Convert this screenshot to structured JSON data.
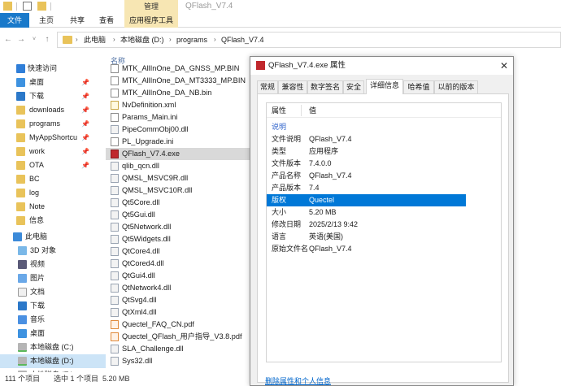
{
  "window": {
    "title": "QFlash_V7.4",
    "manage_label": "管理"
  },
  "ribbon": {
    "tabs": [
      "文件",
      "主页",
      "共享",
      "查看",
      "应用程序工具"
    ]
  },
  "address": {
    "crumbs": [
      "此电脑",
      "本地磁盘 (D:)",
      "programs",
      "QFlash_V7.4"
    ]
  },
  "nav": {
    "items": [
      {
        "label": "快速访问",
        "icon": "star-icon",
        "pinned": false
      },
      {
        "label": "桌面",
        "icon": "desktop-icon",
        "pinned": true
      },
      {
        "label": "下载",
        "icon": "download-icon",
        "pinned": true
      },
      {
        "label": "downloads",
        "icon": "folder-icon",
        "pinned": true
      },
      {
        "label": "programs",
        "icon": "folder-icon",
        "pinned": true
      },
      {
        "label": "MyAppShortcu",
        "icon": "folder-icon",
        "pinned": true
      },
      {
        "label": "work",
        "icon": "folder-icon",
        "pinned": true
      },
      {
        "label": "OTA",
        "icon": "folder-icon",
        "pinned": true
      },
      {
        "label": "BC",
        "icon": "folder-icon",
        "pinned": false
      },
      {
        "label": "log",
        "icon": "folder-icon",
        "pinned": false
      },
      {
        "label": "Note",
        "icon": "folder-icon",
        "pinned": false
      },
      {
        "label": "信息",
        "icon": "folder-icon",
        "pinned": false
      },
      {
        "label": "此电脑",
        "icon": "computer-icon",
        "pinned": false
      },
      {
        "label": "3D 对象",
        "icon": "cube-icon",
        "pinned": false
      },
      {
        "label": "视频",
        "icon": "video-icon",
        "pinned": false
      },
      {
        "label": "图片",
        "icon": "picture-icon",
        "pinned": false
      },
      {
        "label": "文档",
        "icon": "document-icon",
        "pinned": false
      },
      {
        "label": "下载",
        "icon": "download-icon",
        "pinned": false
      },
      {
        "label": "音乐",
        "icon": "music-icon",
        "pinned": false
      },
      {
        "label": "桌面",
        "icon": "desktop-icon",
        "pinned": false
      },
      {
        "label": "本地磁盘 (C:)",
        "icon": "drive-icon",
        "pinned": false
      },
      {
        "label": "本地磁盘 (D:)",
        "icon": "drive-icon",
        "pinned": false
      },
      {
        "label": "本地磁盘 (E:)",
        "icon": "drive-icon",
        "pinned": false
      }
    ]
  },
  "filelist": {
    "column_name": "名称",
    "files": [
      {
        "name": "MTK_AllInOne_DA_GNSS_MP.BIN",
        "type": "file"
      },
      {
        "name": "MTK_AllInOne_DA_MT3333_MP.BIN",
        "type": "file"
      },
      {
        "name": "MTK_AllInOne_DA_NB.bin",
        "type": "file"
      },
      {
        "name": "NvDefinition.xml",
        "type": "xml"
      },
      {
        "name": "Params_Main.ini",
        "type": "file"
      },
      {
        "name": "PipeCommObj00.dll",
        "type": "dll"
      },
      {
        "name": "PL_Upgrade.ini",
        "type": "file"
      },
      {
        "name": "QFlash_V7.4.exe",
        "type": "exe"
      },
      {
        "name": "qlib_qcn.dll",
        "type": "dll"
      },
      {
        "name": "QMSL_MSVC9R.dll",
        "type": "dll"
      },
      {
        "name": "QMSL_MSVC10R.dll",
        "type": "dll"
      },
      {
        "name": "Qt5Core.dll",
        "type": "dll"
      },
      {
        "name": "Qt5Gui.dll",
        "type": "dll"
      },
      {
        "name": "Qt5Network.dll",
        "type": "dll"
      },
      {
        "name": "Qt5Widgets.dll",
        "type": "dll"
      },
      {
        "name": "QtCore4.dll",
        "type": "dll"
      },
      {
        "name": "QtCored4.dll",
        "type": "dll"
      },
      {
        "name": "QtGui4.dll",
        "type": "dll"
      },
      {
        "name": "QtNetwork4.dll",
        "type": "dll"
      },
      {
        "name": "QtSvg4.dll",
        "type": "dll"
      },
      {
        "name": "QtXml4.dll",
        "type": "dll"
      },
      {
        "name": "Quectel_FAQ_CN.pdf",
        "type": "pdf"
      },
      {
        "name": "Quectel_QFlash_用户指导_V3.8.pdf",
        "type": "pdf"
      },
      {
        "name": "SLA_Challenge.dll",
        "type": "dll"
      },
      {
        "name": "Sys32.dll",
        "type": "dll"
      }
    ],
    "selected_file": "QFlash_V7.4.exe"
  },
  "status": {
    "item_count": "111 个项目",
    "selection": "选中 1 个项目",
    "size": "5.20 MB"
  },
  "dialog": {
    "title": "QFlash_V7.4.exe 属性",
    "close_glyph": "✕",
    "tabs": [
      "常规",
      "兼容性",
      "数字签名",
      "安全",
      "详细信息",
      "哈希值",
      "以前的版本"
    ],
    "active_tab": "详细信息",
    "header_property": "属性",
    "header_value": "值",
    "group_label": "说明",
    "rows": [
      {
        "key": "文件说明",
        "value": "QFlash_V7.4"
      },
      {
        "key": "类型",
        "value": "应用程序"
      },
      {
        "key": "文件版本",
        "value": "7.4.0.0"
      },
      {
        "key": "产品名称",
        "value": "QFlash_V7.4"
      },
      {
        "key": "产品版本",
        "value": "7.4"
      },
      {
        "key": "版权",
        "value": "Quectel"
      },
      {
        "key": "大小",
        "value": "5.20 MB"
      },
      {
        "key": "修改日期",
        "value": "2025/2/13 9:42"
      },
      {
        "key": "语言",
        "value": "英语(美国)"
      },
      {
        "key": "原始文件名",
        "value": "QFlash_V7.4"
      }
    ],
    "selected_row": "版权",
    "remove_link": "删除属性和个人信息"
  },
  "colors": {
    "accent": "#0078d7",
    "file_tab": "#1979ca",
    "app_tools": "#f7e6b3",
    "folder": "#e9c35a"
  }
}
